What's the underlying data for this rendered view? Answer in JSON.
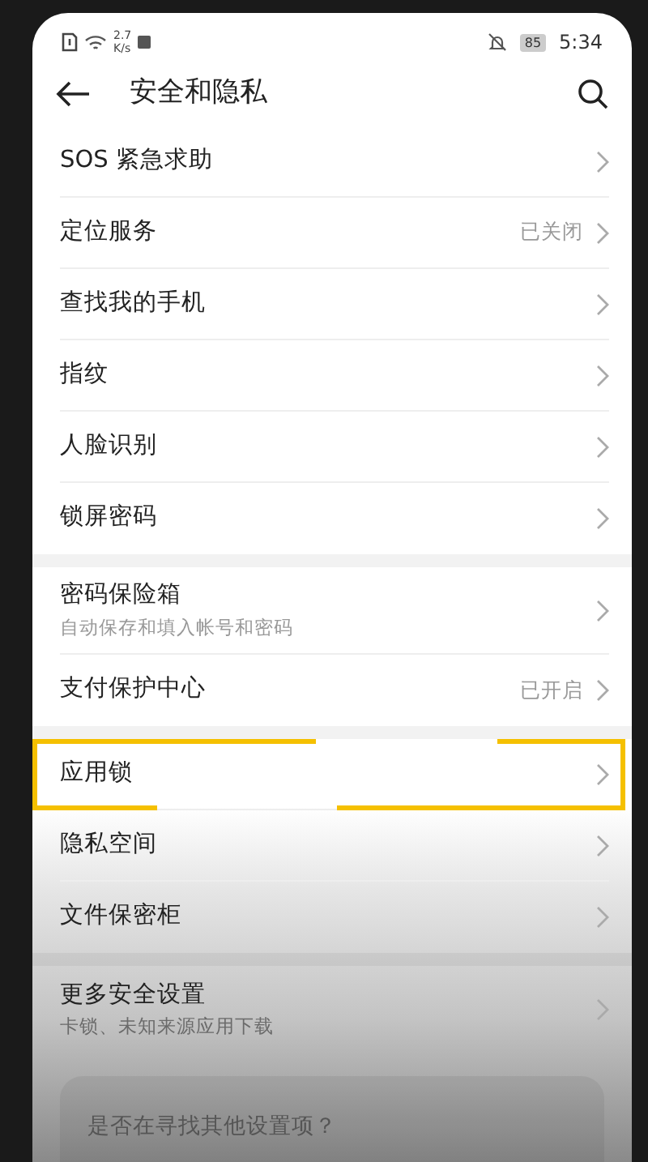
{
  "status_bar": {
    "net_speed": "2.7",
    "net_unit": "K/s",
    "battery": "85",
    "time": "5:34"
  },
  "header": {
    "title": "安全和隐私"
  },
  "groups": [
    {
      "items": [
        {
          "title": "SOS 紧急求助",
          "highlighted": false
        },
        {
          "title": "定位服务",
          "value": "已关闭",
          "highlighted": false
        },
        {
          "title": "查找我的手机",
          "highlighted": false
        },
        {
          "title": "指纹",
          "highlighted": false
        },
        {
          "title": "人脸识别",
          "highlighted": false
        },
        {
          "title": "锁屏密码",
          "highlighted": false
        }
      ]
    },
    {
      "items": [
        {
          "title": "密码保险箱",
          "subtitle": "自动保存和填入帐号和密码",
          "highlighted": false
        },
        {
          "title": "支付保护中心",
          "value": "已开启",
          "highlighted": false
        }
      ]
    },
    {
      "items": [
        {
          "title": "应用锁",
          "highlighted": true
        },
        {
          "title": "隐私空间",
          "highlighted": false
        },
        {
          "title": "文件保密柜",
          "highlighted": false
        }
      ]
    },
    {
      "items": [
        {
          "title": "更多安全设置",
          "subtitle": "卡锁、未知来源应用下载",
          "highlighted": false
        }
      ]
    }
  ],
  "suggestion_card": {
    "text": "是否在寻找其他设置项？"
  }
}
